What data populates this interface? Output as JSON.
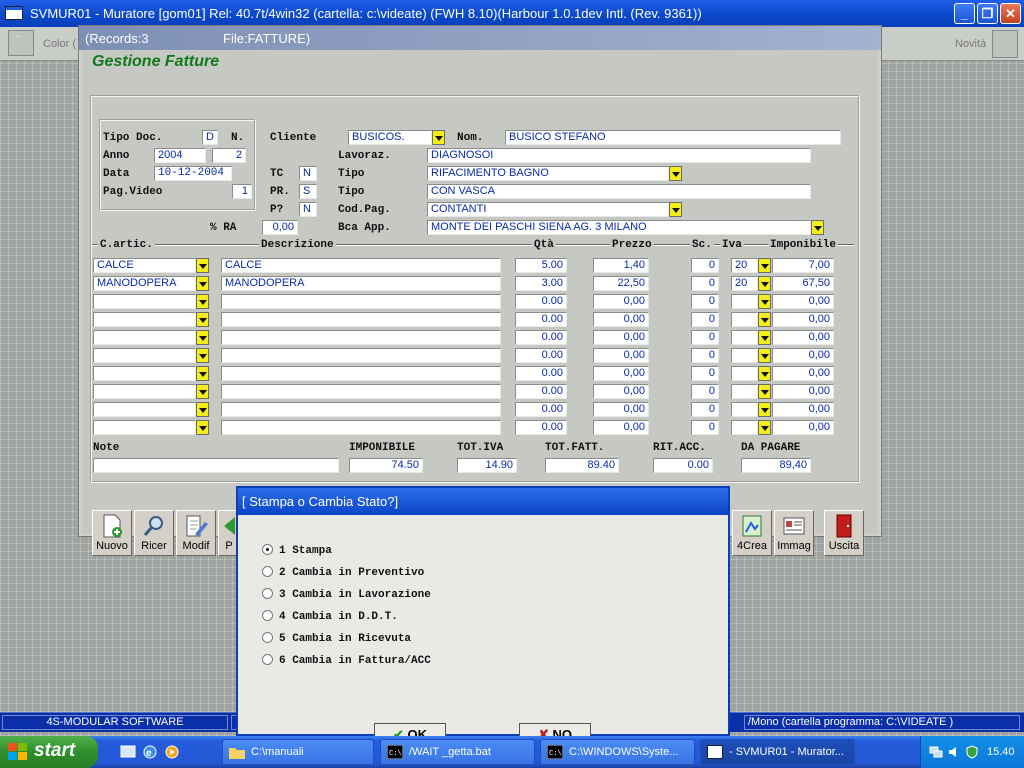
{
  "app": {
    "title": "SVMUR01 - Muratore      [gom01]     Rel: 40.7t/4win32          (cartella: c:\\videate)  (FWH 8.10)(Harbour 1.0.1dev Intl. (Rev. 9361))",
    "toolstrip_left": "Color (",
    "toolstrip_right": "Novità"
  },
  "window": {
    "title_records": "(Records:3",
    "title_file": "File:FATTURE)",
    "heading": "Gestione Fatture"
  },
  "header": {
    "tipo_doc_label": "Tipo Doc.",
    "tipo_doc": "D",
    "n_label": "N.",
    "anno_label": "Anno",
    "anno": "2004",
    "numero": "2",
    "data_label": "Data",
    "data": "10-12-2004",
    "pag_video_label": "Pag.Video",
    "pag_video": "1",
    "cliente_label": "Cliente",
    "cliente": "BUSICOS.",
    "nom_label": "Nom.",
    "nom": "BUSICO STEFANO",
    "lavoraz_label": "Lavoraz.",
    "lavoraz": "DIAGNOSOI",
    "tc_label": "TC",
    "tc": "N",
    "tipo_label": "Tipo",
    "tipo1": "RIFACIMENTO BAGNO",
    "pr_label": "PR.",
    "pr": "S",
    "tipo2": "CON VASCA",
    "p_label": "P?",
    "p": "N",
    "codpag_label": "Cod.Pag.",
    "codpag": "CONTANTI",
    "ra_label": "% RA",
    "ra": "0,00",
    "bca_label": "Bca App.",
    "bca": "MONTE DEI PASCHI SIENA  AG. 3  MILANO"
  },
  "columns": {
    "codice": "C.artic.",
    "descrizione": "Descrizione",
    "qta": "Qtà",
    "prezzo": "Prezzo",
    "sc": "Sc.",
    "iva": "Iva",
    "imponibile": "Imponibile"
  },
  "rows": [
    {
      "codice": "CALCE",
      "descrizione": "CALCE",
      "qta": "5.00",
      "prezzo": "1,40",
      "sc": "0",
      "iva": "20",
      "imponibile": "7,00"
    },
    {
      "codice": "MANODOPERA",
      "descrizione": "MANODOPERA",
      "qta": "3.00",
      "prezzo": "22,50",
      "sc": "0",
      "iva": "20",
      "imponibile": "67,50"
    },
    {
      "codice": "",
      "descrizione": "",
      "qta": "0.00",
      "prezzo": "0,00",
      "sc": "0",
      "iva": "",
      "imponibile": "0,00"
    },
    {
      "codice": "",
      "descrizione": "",
      "qta": "0.00",
      "prezzo": "0,00",
      "sc": "0",
      "iva": "",
      "imponibile": "0,00"
    },
    {
      "codice": "",
      "descrizione": "",
      "qta": "0.00",
      "prezzo": "0,00",
      "sc": "0",
      "iva": "",
      "imponibile": "0,00"
    },
    {
      "codice": "",
      "descrizione": "",
      "qta": "0.00",
      "prezzo": "0,00",
      "sc": "0",
      "iva": "",
      "imponibile": "0,00"
    },
    {
      "codice": "",
      "descrizione": "",
      "qta": "0.00",
      "prezzo": "0,00",
      "sc": "0",
      "iva": "",
      "imponibile": "0,00"
    },
    {
      "codice": "",
      "descrizione": "",
      "qta": "0.00",
      "prezzo": "0,00",
      "sc": "0",
      "iva": "",
      "imponibile": "0,00"
    },
    {
      "codice": "",
      "descrizione": "",
      "qta": "0.00",
      "prezzo": "0,00",
      "sc": "0",
      "iva": "",
      "imponibile": "0,00"
    },
    {
      "codice": "",
      "descrizione": "",
      "qta": "0.00",
      "prezzo": "0,00",
      "sc": "0",
      "iva": "",
      "imponibile": "0,00"
    }
  ],
  "totals": {
    "note_label": "Note",
    "note": "",
    "imponibile_label": "IMPONIBILE",
    "imponibile": "74.50",
    "totiva_label": "TOT.IVA",
    "totiva": "14.90",
    "totfatt_label": "TOT.FATT.",
    "totfatt": "89.40",
    "ritacc_label": "RIT.ACC.",
    "ritacc": "0.00",
    "dapagare_label": "DA PAGARE",
    "dapagare": "89,40"
  },
  "toolbar": {
    "nuovo": "Nuovo",
    "ricer": "Ricer",
    "modif": "Modif",
    "p_partial": "P",
    "crea4": "4Crea",
    "immag": "Immag",
    "uscita": "Uscita"
  },
  "dialog": {
    "title": "[ Stampa o Cambia Stato?]",
    "options": [
      "1 Stampa",
      "2 Cambia in Preventivo",
      "3 Cambia in Lavorazione",
      "4 Cambia in D.D.T.",
      "5 Cambia in Ricevuta",
      "6 Cambia in Fattura/ACC"
    ],
    "selected_index": 0,
    "ok_partial": "OK",
    "no_partial": "NO"
  },
  "statusbar": {
    "left": "4S-MODULAR SOFTWARE",
    "right": "/Mono  (cartella programma: C:\\VIDEATE )"
  },
  "taskbar": {
    "start": "start",
    "tasks": [
      "C:\\manuali",
      "/WAIT _getta.bat",
      "C:\\WINDOWS\\Syste...",
      "- SVMUR01 - Murator..."
    ],
    "clock": "15.40"
  },
  "colors": {
    "accent": "#0a47c9",
    "value_text": "#0a2aa6",
    "heading": "#0f7a1a",
    "dropdown": "#f2ee1a"
  }
}
